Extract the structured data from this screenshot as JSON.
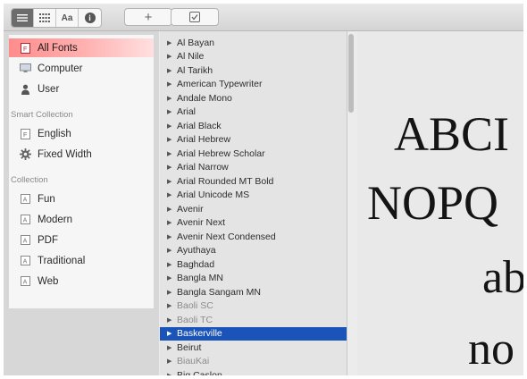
{
  "toolbar": {
    "view_buttons": [
      {
        "name": "list-view-icon",
        "active": true
      },
      {
        "name": "grid-view-icon",
        "active": false
      },
      {
        "name": "sample-view-icon",
        "label": "Aa"
      },
      {
        "name": "info-icon",
        "label": "i"
      }
    ],
    "add_label": "+",
    "validate_icon": "checkbox-icon"
  },
  "sidebar": {
    "library_items": [
      {
        "label": "All Fonts",
        "icon": "font-file-icon",
        "selected": true
      },
      {
        "label": "Computer",
        "icon": "monitor-icon",
        "selected": false
      },
      {
        "label": "User",
        "icon": "user-icon",
        "selected": false
      }
    ],
    "smart_heading": "Smart Collection",
    "smart_items": [
      {
        "label": "English",
        "icon": "font-file-icon"
      },
      {
        "label": "Fixed Width",
        "icon": "gear-icon"
      }
    ],
    "collection_heading": "Collection",
    "collection_items": [
      {
        "label": "Fun",
        "icon": "collection-icon"
      },
      {
        "label": "Modern",
        "icon": "collection-icon"
      },
      {
        "label": "PDF",
        "icon": "collection-icon"
      },
      {
        "label": "Traditional",
        "icon": "collection-icon"
      },
      {
        "label": "Web",
        "icon": "collection-icon"
      }
    ]
  },
  "font_list": [
    {
      "name": "Al Bayan",
      "state": "normal"
    },
    {
      "name": "Al Nile",
      "state": "normal"
    },
    {
      "name": "Al Tarikh",
      "state": "normal"
    },
    {
      "name": "American Typewriter",
      "state": "normal"
    },
    {
      "name": "Andale Mono",
      "state": "normal"
    },
    {
      "name": "Arial",
      "state": "normal"
    },
    {
      "name": "Arial Black",
      "state": "normal"
    },
    {
      "name": "Arial Hebrew",
      "state": "normal"
    },
    {
      "name": "Arial Hebrew Scholar",
      "state": "normal"
    },
    {
      "name": "Arial Narrow",
      "state": "normal"
    },
    {
      "name": "Arial Rounded MT Bold",
      "state": "normal"
    },
    {
      "name": "Arial Unicode MS",
      "state": "normal"
    },
    {
      "name": "Avenir",
      "state": "normal"
    },
    {
      "name": "Avenir Next",
      "state": "normal"
    },
    {
      "name": "Avenir Next Condensed",
      "state": "normal"
    },
    {
      "name": "Ayuthaya",
      "state": "normal"
    },
    {
      "name": "Baghdad",
      "state": "normal"
    },
    {
      "name": "Bangla MN",
      "state": "normal"
    },
    {
      "name": "Bangla Sangam MN",
      "state": "normal"
    },
    {
      "name": "Baoli SC",
      "state": "dim"
    },
    {
      "name": "Baoli TC",
      "state": "dim"
    },
    {
      "name": "Baskerville",
      "state": "selected"
    },
    {
      "name": "Beirut",
      "state": "normal"
    },
    {
      "name": "BiauKai",
      "state": "dim"
    },
    {
      "name": "Big Caslon",
      "state": "normal"
    }
  ],
  "preview": {
    "lines": [
      "ABCI",
      "NOPQ",
      "ab",
      "no"
    ]
  },
  "colors": {
    "selection_blue": "#1b54b8",
    "sidebar_selected": "#ff9a9a"
  }
}
